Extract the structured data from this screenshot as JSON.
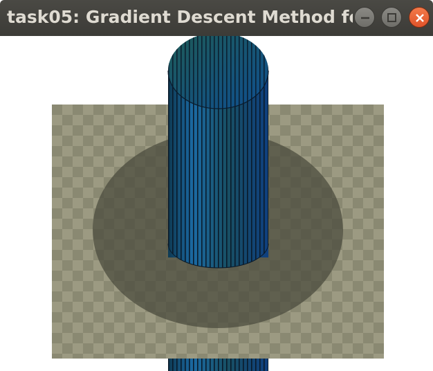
{
  "window": {
    "title": "task05: Gradient Descent Method fo…",
    "buttons": {
      "minimize": "minimize",
      "maximize": "maximize",
      "close": "close"
    }
  },
  "scene": {
    "background": "#ffffff",
    "checker_light": "#9c9a82",
    "checker_dark": "#8a8972",
    "disk_color": "#4a4a3c",
    "cylinder_colors": [
      "#0f4f8f",
      "#1b6aa3",
      "#184f63",
      "#0e3a53"
    ],
    "cylinder_top_color": "#1e5a56",
    "stripe_color": "#0a1a2a"
  }
}
